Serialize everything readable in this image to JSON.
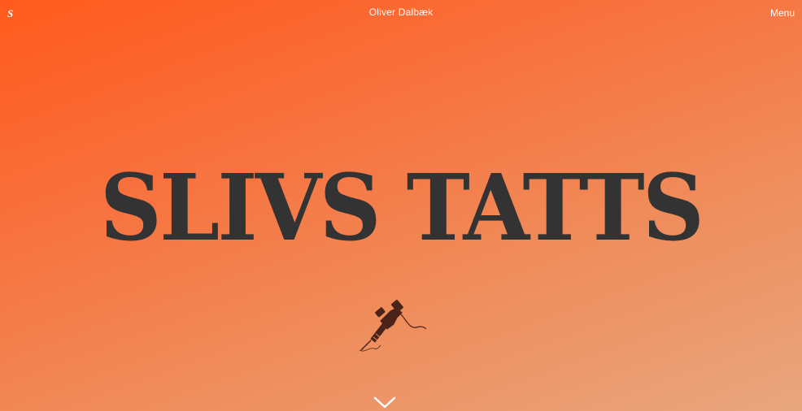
{
  "header": {
    "logo_text": "S",
    "site_name": "Oliver Dalbæk",
    "menu_label": "Menu"
  },
  "hero": {
    "title": "SLIVS TATTS",
    "illustration_icon": "tattoo-machine-icon",
    "scroll_icon": "chevron-down-icon"
  },
  "colors": {
    "gradient_start": "#ff5a1c",
    "gradient_end": "#e8a67e",
    "title_color": "#333333",
    "header_text": "#ffffff",
    "illustration": "#4a2418"
  }
}
